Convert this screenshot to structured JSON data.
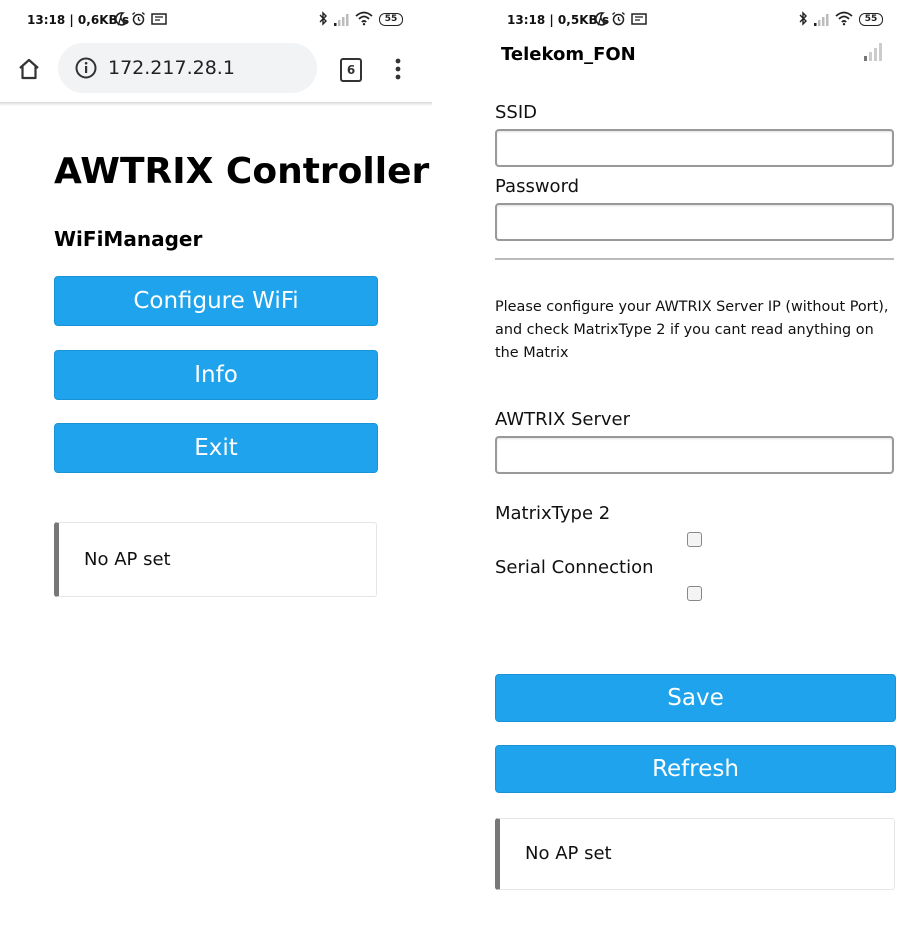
{
  "left_phone": {
    "status": {
      "time_net": "13:18 | 0,6KB/s",
      "battery": "55"
    },
    "browser": {
      "url": "172.217.28.1",
      "tab_count": "6"
    },
    "page": {
      "title": "AWTRIX Controller",
      "subtitle": "WiFiManager",
      "buttons": [
        "Configure WiFi",
        "Info",
        "Exit"
      ],
      "message": "No AP set"
    }
  },
  "right_phone": {
    "status": {
      "time_net": "13:18 | 0,5KB/s",
      "battery": "55"
    },
    "network_name": "Telekom_FON",
    "form": {
      "ssid_label": "SSID",
      "password_label": "Password",
      "info_text": "Please configure your AWTRIX Server IP (without Port), and check MatrixType 2 if you cant read anything on the Matrix",
      "server_label": "AWTRIX Server",
      "matrix_label": "MatrixType 2",
      "serial_label": "Serial Connection",
      "save_label": "Save",
      "refresh_label": "Refresh",
      "message": "No AP set"
    }
  },
  "colors": {
    "button_bg": "#1fa3ec",
    "msg_border": "#777777"
  }
}
